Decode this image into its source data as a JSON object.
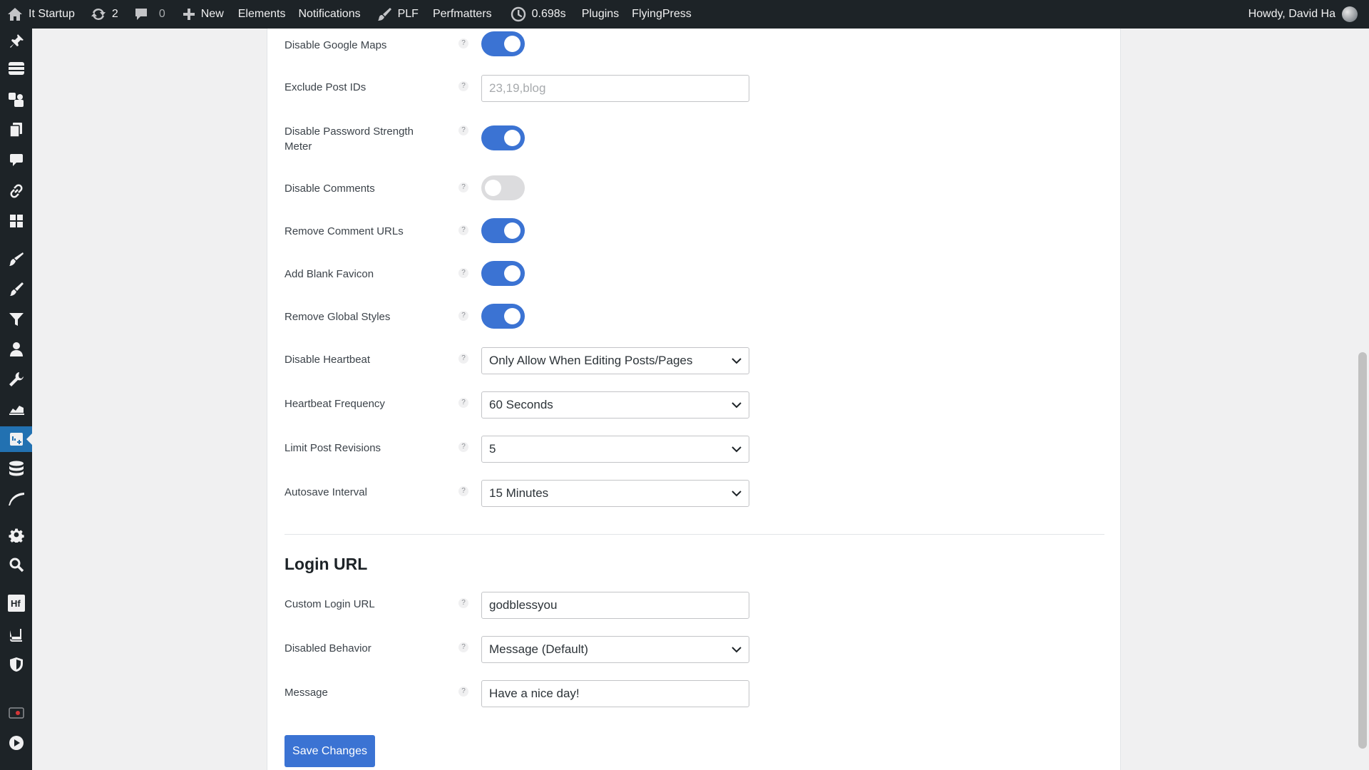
{
  "adminbar": {
    "site_name": "It Startup",
    "updates_count": "2",
    "comments_count": "0",
    "new_label": "New",
    "elements_label": "Elements",
    "notifications_label": "Notifications",
    "plf_label": "PLF",
    "perfmatters_label": "Perfmatters",
    "timer_label": "0.698s",
    "plugins_label": "Plugins",
    "flyingpress_label": "FlyingPress",
    "howdy_label": "Howdy, David Ha"
  },
  "menu_icons": [
    "pin-icon",
    "dashboard-icon",
    "media-icon",
    "pages-icon",
    "comments-icon",
    "links-icon",
    "blocks-icon",
    "appearance-icon",
    "plugins-icon",
    "filter-icon",
    "users-icon",
    "tools-icon",
    "chart-icon",
    "perfmatters-icon",
    "database-icon",
    "feather-icon",
    "settings-icon",
    "search-icon",
    "hf-icon",
    "book-icon",
    "shield-icon",
    "record-icon",
    "play-icon"
  ],
  "settings": {
    "disable_google_maps": {
      "label": "Disable Google Maps",
      "on": true
    },
    "exclude_post_ids": {
      "label": "Exclude Post IDs",
      "placeholder": "23,19,blog"
    },
    "disable_password_meter": {
      "label": "Disable Password Strength Meter",
      "on": true
    },
    "disable_comments": {
      "label": "Disable Comments",
      "on": false
    },
    "remove_comment_urls": {
      "label": "Remove Comment URLs",
      "on": true
    },
    "add_blank_favicon": {
      "label": "Add Blank Favicon",
      "on": true
    },
    "remove_global_styles": {
      "label": "Remove Global Styles",
      "on": true
    },
    "disable_heartbeat": {
      "label": "Disable Heartbeat",
      "value": "Only Allow When Editing Posts/Pages"
    },
    "heartbeat_frequency": {
      "label": "Heartbeat Frequency",
      "value": "60 Seconds"
    },
    "limit_post_revisions": {
      "label": "Limit Post Revisions",
      "value": "5"
    },
    "autosave_interval": {
      "label": "Autosave Interval",
      "value": "15 Minutes"
    }
  },
  "login_url": {
    "title": "Login URL",
    "custom_login_url": {
      "label": "Custom Login URL",
      "value": "godblessyou"
    },
    "disabled_behavior": {
      "label": "Disabled Behavior",
      "value": "Message (Default)"
    },
    "message": {
      "label": "Message",
      "value": "Have a nice day!"
    }
  },
  "help_glyph": "?",
  "save_button": "Save Changes",
  "colors": {
    "accent": "#3b73d3",
    "adminbar": "#1d2327",
    "current_menu": "#2271b1"
  }
}
